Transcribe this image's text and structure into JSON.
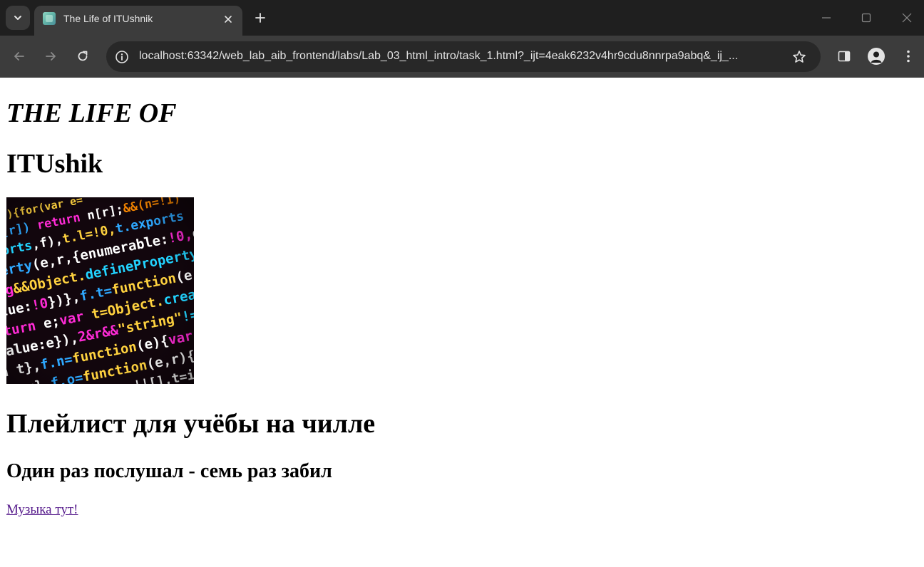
{
  "browser": {
    "tab": {
      "title": "The Life of ITUshnik"
    },
    "address_bar": {
      "url": "localhost:63342/web_lab_aib_frontend/labs/Lab_03_html_intro/task_1.html?_ijt=4eak6232v4hr9cdu8nnrpa9abq&_ij_..."
    },
    "icons": {
      "tab_search": "chevron-down-icon",
      "tab_favicon": "page-favicon",
      "tab_close": "close-icon",
      "new_tab": "plus-icon",
      "minimize": "minimize-icon",
      "maximize": "maximize-icon",
      "close_window": "close-icon",
      "back": "back-arrow-icon",
      "forward": "forward-arrow-icon",
      "reload": "reload-icon",
      "site_info": "info-icon",
      "bookmark": "star-icon",
      "side_panel": "side-panel-icon",
      "profile": "profile-icon",
      "menu": "kebab-menu-icon"
    },
    "colors": {
      "tabstrip": "#1f1f1f",
      "toolbar": "#3c3c3c",
      "omnibox": "#282828",
      "chrome_text": "#e3e3e3"
    }
  },
  "page": {
    "heading_italic": "THE LIFE OF",
    "heading_name": "ITUshik",
    "image_alt": "code-screenshot",
    "playlist_heading": "Плейлист для учёбы на чилле",
    "tagline": "Один раз послушал - семь раз забил",
    "music_link": "Музыка тут!",
    "colors": {
      "background": "#ffffff",
      "text": "#000000",
      "visited_link": "#551a8b"
    }
  }
}
